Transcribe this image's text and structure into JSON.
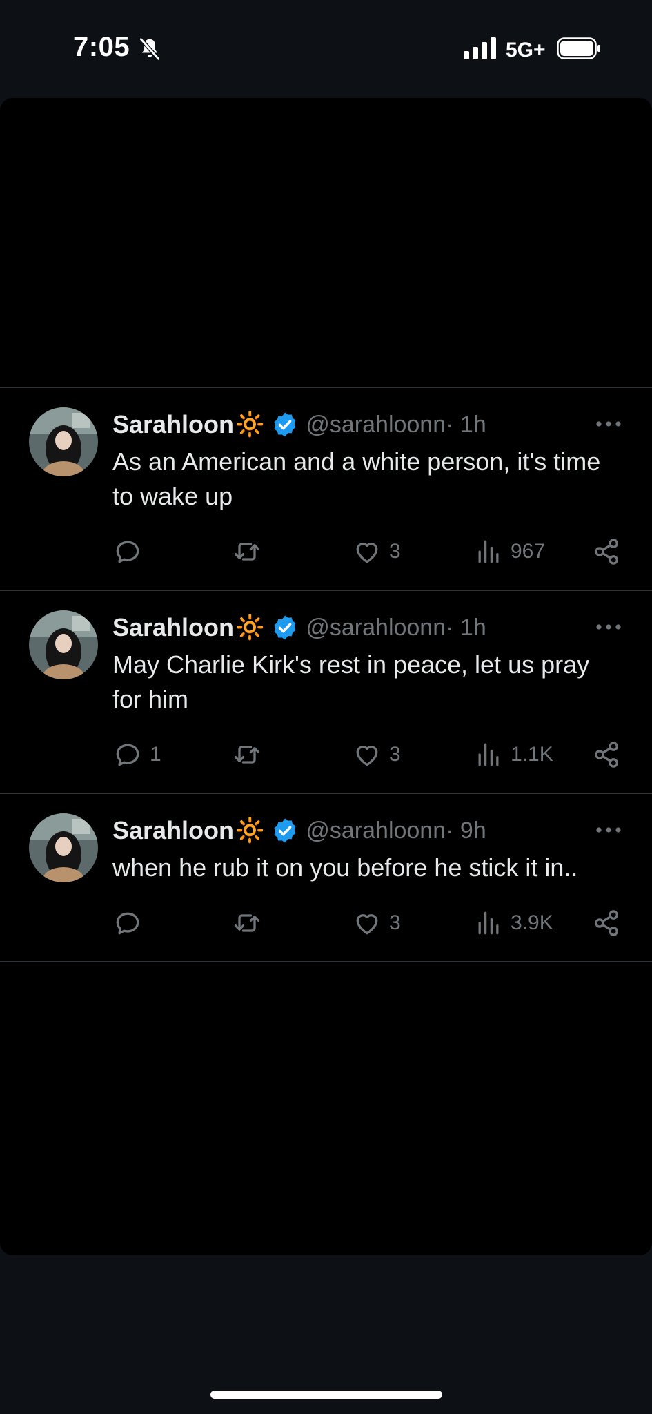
{
  "status_bar": {
    "time": "7:05",
    "network": "5G+",
    "icons": [
      "bell-slash-icon",
      "signal-bars-icon",
      "battery-icon"
    ]
  },
  "colors": {
    "background": "#0d1014",
    "card": "#000000",
    "text": "#e7e9ea",
    "muted": "#71767b",
    "verified": "#1d9bf0",
    "divider": "#2f3336"
  },
  "tweets": [
    {
      "display_name": "Sarahloon",
      "emoji": "🔆",
      "handle": "@sarahloonn",
      "time": " · 1h",
      "text": "As an American and a white person, it's time to wake up",
      "reply_count": "",
      "retweet_count": "",
      "like_count": "3",
      "view_count": "967"
    },
    {
      "display_name": "Sarahloon",
      "emoji": "🔆",
      "handle": "@sarahloonn",
      "time": " · 1h",
      "text": "May Charlie Kirk's rest in peace, let us pray for him",
      "reply_count": "1",
      "retweet_count": "",
      "like_count": "3",
      "view_count": "1.1K"
    },
    {
      "display_name": "Sarahloon",
      "emoji": "🔆",
      "handle": "@sarahloonn",
      "time": " · 9h",
      "text": "when he rub it on you before he stick it in..",
      "reply_count": "",
      "retweet_count": "",
      "like_count": "3",
      "view_count": "3.9K"
    }
  ]
}
